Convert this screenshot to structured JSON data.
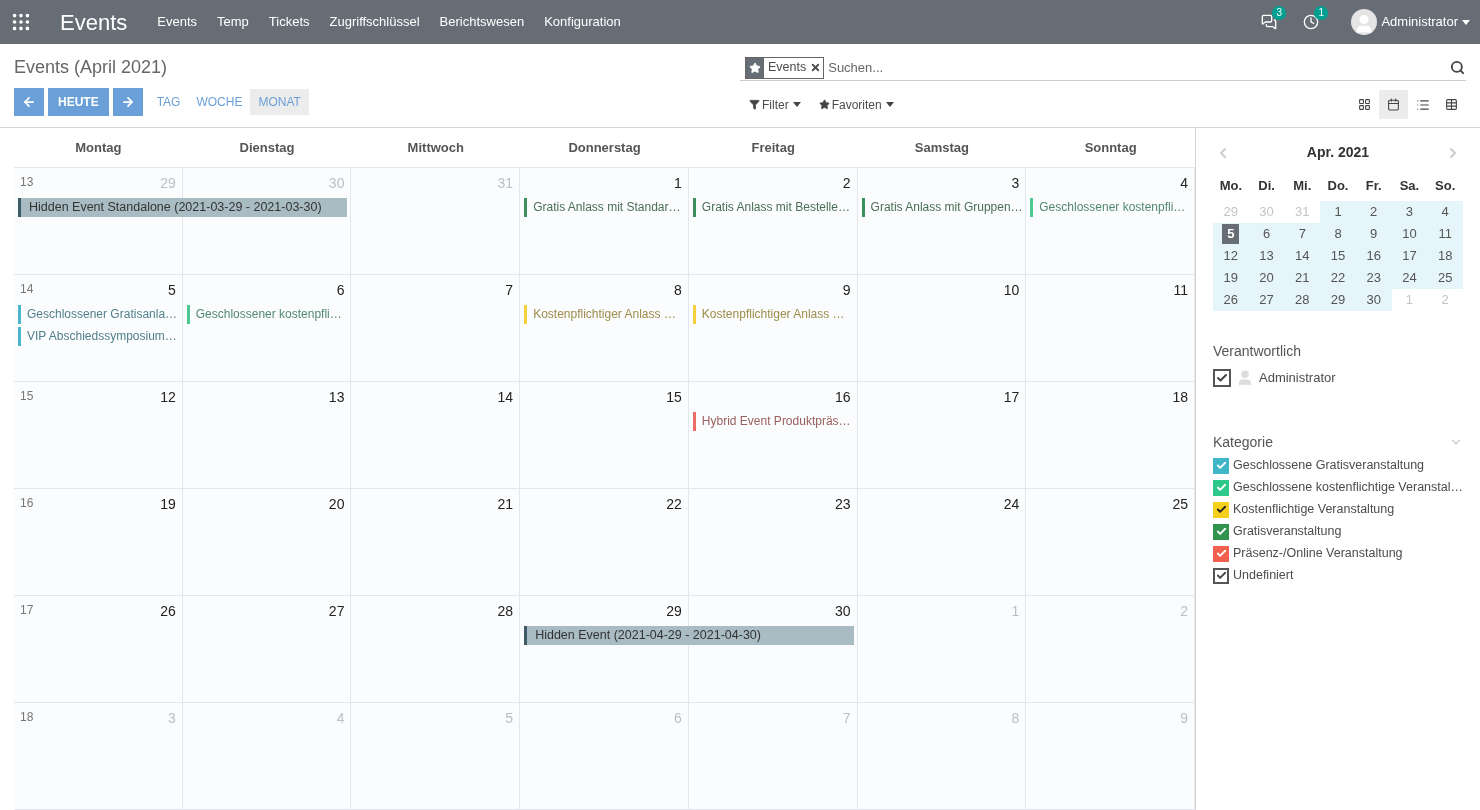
{
  "navbar": {
    "app_title": "Events",
    "menu": [
      "Events",
      "Temp",
      "Tickets",
      "Zugriffschlüssel",
      "Berichtswesen",
      "Konfiguration"
    ],
    "messages_badge": "3",
    "activities_badge": "1",
    "user": "Administrator"
  },
  "control_panel": {
    "title": "Events (April 2021)",
    "today_button": "HEUTE",
    "scales": [
      {
        "label": "TAG",
        "selected": false
      },
      {
        "label": "WOCHE",
        "selected": false
      },
      {
        "label": "MONAT",
        "selected": true
      }
    ],
    "search": {
      "facet": "Events",
      "placeholder": "Suchen..."
    },
    "filter_label": "Filter",
    "favorites_label": "Favoriten",
    "views": [
      {
        "kind": "kanban",
        "selected": false
      },
      {
        "kind": "calendar",
        "selected": true
      },
      {
        "kind": "list",
        "selected": false
      },
      {
        "kind": "pivot",
        "selected": false
      }
    ]
  },
  "calendar": {
    "weekdays": [
      "Montag",
      "Dienstag",
      "Mittwoch",
      "Donnerstag",
      "Freitag",
      "Samstag",
      "Sonntag"
    ],
    "weeks": [
      {
        "number": "13",
        "days": [
          {
            "day": "29",
            "muted": true,
            "events": [
              {
                "title": "Hidden Event Standalone (2021-03-29 - 2021-03-30)",
                "kind": "span",
                "color": "#3d5a66"
              }
            ]
          },
          {
            "day": "30",
            "muted": true,
            "events": [
              {
                "kind": "continuation"
              }
            ]
          },
          {
            "day": "31",
            "muted": true
          },
          {
            "day": "1",
            "muted": false,
            "events": [
              {
                "title": "Gratis Anlass mit Standar…",
                "kind": "chip",
                "color": "#3c8f5a"
              }
            ]
          },
          {
            "day": "2",
            "muted": false,
            "events": [
              {
                "title": "Gratis Anlass mit Bestelle…",
                "kind": "chip",
                "color": "#3c8f5a"
              }
            ]
          },
          {
            "day": "3",
            "muted": false,
            "events": [
              {
                "title": "Gratis Anlass mit Gruppen…",
                "kind": "chip",
                "color": "#3c8f5a"
              }
            ]
          },
          {
            "day": "4",
            "muted": false,
            "events": [
              {
                "title": "Geschlossener kostenpfli…",
                "kind": "chip",
                "color": "#4cc890"
              }
            ]
          }
        ]
      },
      {
        "number": "14",
        "days": [
          {
            "day": "5",
            "muted": false,
            "events": [
              {
                "title": "Geschlossener Gratisanla…",
                "kind": "chip",
                "color": "#4db6cc"
              },
              {
                "title": "VIP Abschiedssymposium…",
                "kind": "chip",
                "color": "#4db6cc"
              }
            ]
          },
          {
            "day": "6",
            "muted": false,
            "events": [
              {
                "title": "Geschlossener kostenpfli…",
                "kind": "chip",
                "color": "#4cc890"
              }
            ]
          },
          {
            "day": "7",
            "muted": false
          },
          {
            "day": "8",
            "muted": false,
            "events": [
              {
                "title": "Kostenpflichtiger Anlass …",
                "kind": "chip",
                "color": "#f5d03c"
              }
            ]
          },
          {
            "day": "9",
            "muted": false,
            "events": [
              {
                "title": "Kostenpflichtiger Anlass …",
                "kind": "chip",
                "color": "#f5d03c"
              }
            ]
          },
          {
            "day": "10",
            "muted": false
          },
          {
            "day": "11",
            "muted": false
          }
        ]
      },
      {
        "number": "15",
        "days": [
          {
            "day": "12",
            "muted": false
          },
          {
            "day": "13",
            "muted": false
          },
          {
            "day": "14",
            "muted": false
          },
          {
            "day": "15",
            "muted": false
          },
          {
            "day": "16",
            "muted": false,
            "events": [
              {
                "title": "Hybrid Event Produktpräs…",
                "kind": "chip",
                "color": "#ec6e66"
              }
            ]
          },
          {
            "day": "17",
            "muted": false
          },
          {
            "day": "18",
            "muted": false
          }
        ]
      },
      {
        "number": "16",
        "days": [
          {
            "day": "19",
            "muted": false
          },
          {
            "day": "20",
            "muted": false
          },
          {
            "day": "21",
            "muted": false
          },
          {
            "day": "22",
            "muted": false
          },
          {
            "day": "23",
            "muted": false
          },
          {
            "day": "24",
            "muted": false
          },
          {
            "day": "25",
            "muted": false
          }
        ]
      },
      {
        "number": "17",
        "days": [
          {
            "day": "26",
            "muted": false
          },
          {
            "day": "27",
            "muted": false
          },
          {
            "day": "28",
            "muted": false
          },
          {
            "day": "29",
            "muted": false,
            "events": [
              {
                "title": "Hidden Event (2021-04-29 - 2021-04-30)",
                "kind": "span",
                "color": "#3d5a66"
              }
            ]
          },
          {
            "day": "30",
            "muted": false,
            "events": [
              {
                "kind": "continuation"
              }
            ]
          },
          {
            "day": "1",
            "muted": true
          },
          {
            "day": "2",
            "muted": true
          }
        ]
      },
      {
        "number": "18",
        "days": [
          {
            "day": "3",
            "muted": true
          },
          {
            "day": "4",
            "muted": true
          },
          {
            "day": "5",
            "muted": true
          },
          {
            "day": "6",
            "muted": true
          },
          {
            "day": "7",
            "muted": true
          },
          {
            "day": "8",
            "muted": true
          },
          {
            "day": "9",
            "muted": true
          }
        ]
      }
    ]
  },
  "sidebar": {
    "mini_calendar": {
      "title": "Apr. 2021",
      "weekdays": [
        "Mo.",
        "Di.",
        "Mi.",
        "Do.",
        "Fr.",
        "Sa.",
        "So."
      ],
      "weeks": [
        [
          {
            "day": "29",
            "muted": true,
            "highlighted": false,
            "selected": false
          },
          {
            "day": "30",
            "muted": true,
            "highlighted": false,
            "selected": false
          },
          {
            "day": "31",
            "muted": true,
            "highlighted": false,
            "selected": false
          },
          {
            "day": "1",
            "muted": false,
            "highlighted": true,
            "selected": false
          },
          {
            "day": "2",
            "muted": false,
            "highlighted": true,
            "selected": false
          },
          {
            "day": "3",
            "muted": false,
            "highlighted": true,
            "selected": false
          },
          {
            "day": "4",
            "muted": false,
            "highlighted": true,
            "selected": false
          }
        ],
        [
          {
            "day": "5",
            "muted": false,
            "highlighted": true,
            "selected": true
          },
          {
            "day": "6",
            "muted": false,
            "highlighted": true,
            "selected": false
          },
          {
            "day": "7",
            "muted": false,
            "highlighted": true,
            "selected": false
          },
          {
            "day": "8",
            "muted": false,
            "highlighted": true,
            "selected": false
          },
          {
            "day": "9",
            "muted": false,
            "highlighted": true,
            "selected": false
          },
          {
            "day": "10",
            "muted": false,
            "highlighted": true,
            "selected": false
          },
          {
            "day": "11",
            "muted": false,
            "highlighted": true,
            "selected": false
          }
        ],
        [
          {
            "day": "12",
            "muted": false,
            "highlighted": true,
            "selected": false
          },
          {
            "day": "13",
            "muted": false,
            "highlighted": true,
            "selected": false
          },
          {
            "day": "14",
            "muted": false,
            "highlighted": true,
            "selected": false
          },
          {
            "day": "15",
            "muted": false,
            "highlighted": true,
            "selected": false
          },
          {
            "day": "16",
            "muted": false,
            "highlighted": true,
            "selected": false
          },
          {
            "day": "17",
            "muted": false,
            "highlighted": true,
            "selected": false
          },
          {
            "day": "18",
            "muted": false,
            "highlighted": true,
            "selected": false
          }
        ],
        [
          {
            "day": "19",
            "muted": false,
            "highlighted": true,
            "selected": false
          },
          {
            "day": "20",
            "muted": false,
            "highlighted": true,
            "selected": false
          },
          {
            "day": "21",
            "muted": false,
            "highlighted": true,
            "selected": false
          },
          {
            "day": "22",
            "muted": false,
            "highlighted": true,
            "selected": false
          },
          {
            "day": "23",
            "muted": false,
            "highlighted": true,
            "selected": false
          },
          {
            "day": "24",
            "muted": false,
            "highlighted": true,
            "selected": false
          },
          {
            "day": "25",
            "muted": false,
            "highlighted": true,
            "selected": false
          }
        ],
        [
          {
            "day": "26",
            "muted": false,
            "highlighted": true,
            "selected": false
          },
          {
            "day": "27",
            "muted": false,
            "highlighted": true,
            "selected": false
          },
          {
            "day": "28",
            "muted": false,
            "highlighted": true,
            "selected": false
          },
          {
            "day": "29",
            "muted": false,
            "highlighted": true,
            "selected": false
          },
          {
            "day": "30",
            "muted": false,
            "highlighted": true,
            "selected": false
          },
          {
            "day": "1",
            "muted": true,
            "highlighted": false,
            "selected": false
          },
          {
            "day": "2",
            "muted": true,
            "highlighted": false,
            "selected": false
          }
        ]
      ]
    },
    "responsible": {
      "title": "Verantwortlich",
      "items": [
        {
          "label": "Administrator",
          "checked": true
        }
      ]
    },
    "category": {
      "title": "Kategorie",
      "items": [
        {
          "label": "Geschlossene Gratisveranstaltung",
          "checked": true,
          "color": "#3fb5c8"
        },
        {
          "label": "Geschlossene kostenflichtige Veranstal…",
          "checked": true,
          "color": "#2ec98a"
        },
        {
          "label": "Kostenflichtige Veranstaltung",
          "checked": true,
          "color": "#f6d01c"
        },
        {
          "label": "Gratisveranstaltung",
          "checked": true,
          "color": "#30944f"
        },
        {
          "label": "Präsenz-/Online Veranstaltung",
          "checked": true,
          "color": "#f2604f"
        },
        {
          "label": "Undefiniert",
          "checked": true
        }
      ]
    }
  }
}
